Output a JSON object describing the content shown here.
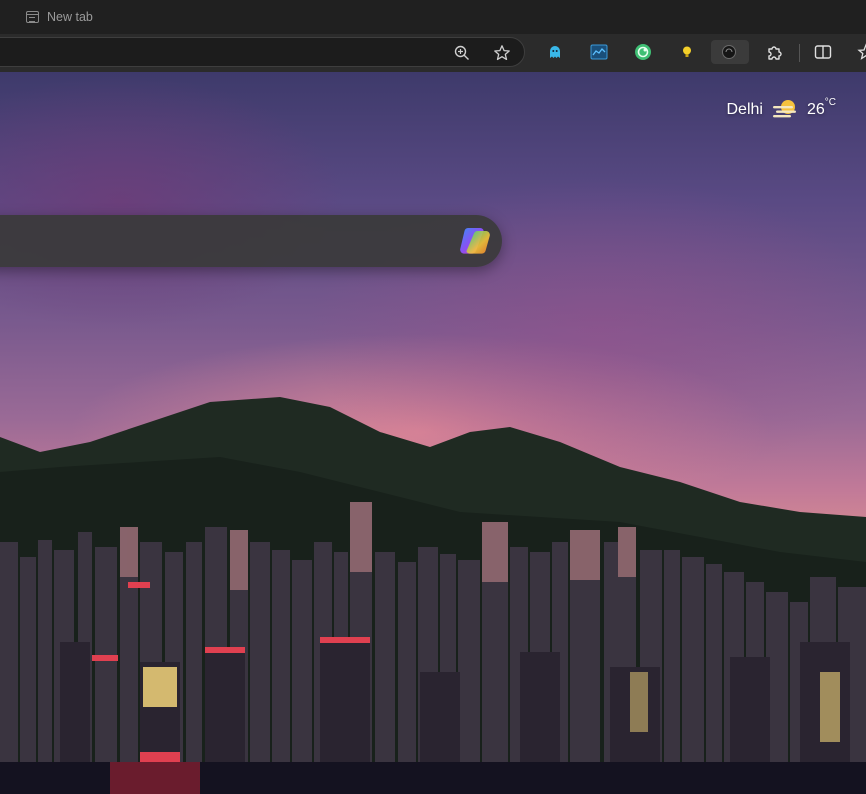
{
  "tabs": [
    {
      "title": "New tab"
    }
  ],
  "toolbar": {
    "address_icons": [
      "zoom-icon",
      "favorite-star-icon"
    ],
    "extensions": [
      "ghost-extension-icon",
      "chart-extension-icon",
      "green-circle-extension-icon",
      "bulb-extension-icon",
      "dark-extension-icon",
      "extensions-puzzle-icon",
      "split-screen-icon",
      "favorites-icon"
    ]
  },
  "weather": {
    "city": "Delhi",
    "temperature": "26",
    "unit": "°C",
    "icon": "haze-sun-icon"
  },
  "search": {
    "placeholder": "",
    "assistant_icon": "copilot-icon"
  },
  "colors": {
    "chrome_dark": "#202020",
    "toolbar": "#2b2b2b",
    "searchbox": "#3a3a3a"
  }
}
